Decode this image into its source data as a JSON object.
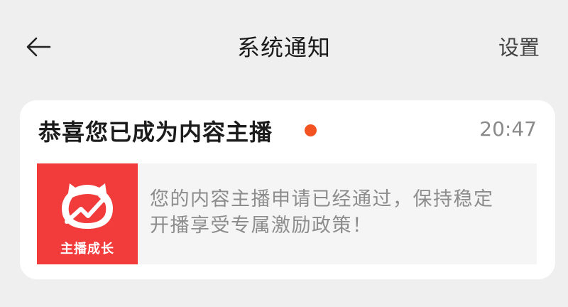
{
  "header": {
    "back_icon": "arrow-left-icon",
    "title": "系统通知",
    "settings_label": "设置"
  },
  "notification": {
    "title": "恭喜您已成为内容主播",
    "unread": true,
    "unread_color": "#f25320",
    "time": "20:47",
    "thumbnail": {
      "icon": "growth-chart-icon",
      "label": "主播成长",
      "color": "#f23c3c"
    },
    "message_line1": "您的内容主播申请已经通过，保持稳定",
    "message_line2": "开播享受专属激励政策！"
  }
}
